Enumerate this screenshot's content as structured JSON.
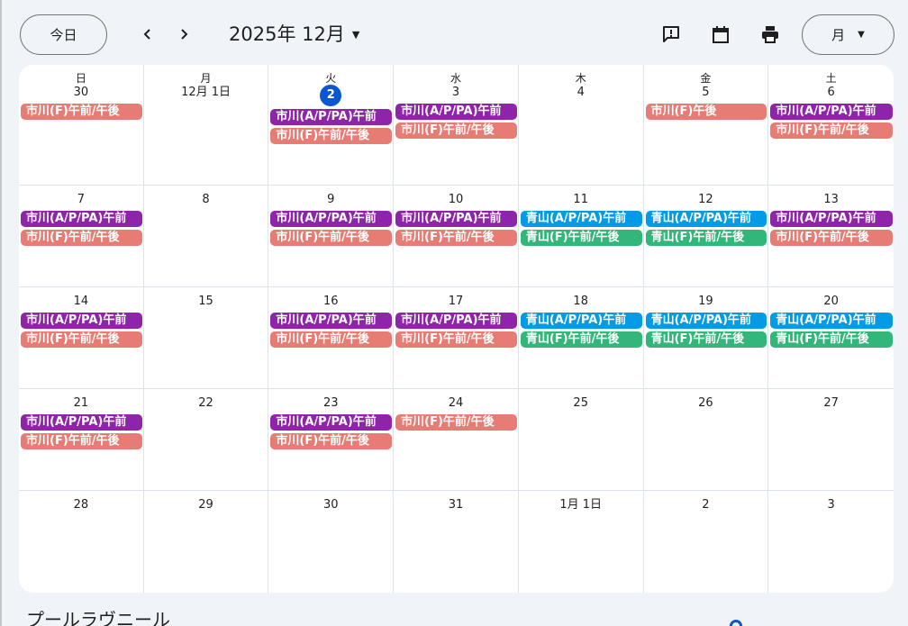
{
  "toolbar": {
    "today_label": "今日",
    "prev_label": "‹",
    "next_label": "›",
    "month_title": "2025年 12月",
    "view_label": "月",
    "caret": "▼"
  },
  "colors": {
    "ichikawa_ap": "#8e24aa",
    "ichikawa_f": "#e67c73",
    "aoyama_ap": "#039be5",
    "aoyama_f": "#33b679",
    "today_badge": "#0b57d0"
  },
  "weekdays": [
    "日",
    "月",
    "火",
    "水",
    "木",
    "金",
    "土"
  ],
  "weeks": [
    [
      {
        "label": "30",
        "events": [
          {
            "text": "市川(F)午前/午後",
            "type": "ichikawa-f"
          }
        ]
      },
      {
        "label": "12月 1日",
        "events": []
      },
      {
        "label": "2",
        "today": true,
        "events": [
          {
            "text": "市川(A/P/PA)午前",
            "type": "ichikawa-a"
          },
          {
            "text": "市川(F)午前/午後",
            "type": "ichikawa-f"
          }
        ]
      },
      {
        "label": "3",
        "events": [
          {
            "text": "市川(A/P/PA)午前",
            "type": "ichikawa-a"
          },
          {
            "text": "市川(F)午前/午後",
            "type": "ichikawa-f"
          }
        ]
      },
      {
        "label": "4",
        "events": []
      },
      {
        "label": "5",
        "events": [
          {
            "text": "市川(F)午後",
            "type": "ichikawa-f"
          }
        ]
      },
      {
        "label": "6",
        "events": [
          {
            "text": "市川(A/P/PA)午前",
            "type": "ichikawa-a"
          },
          {
            "text": "市川(F)午前/午後",
            "type": "ichikawa-f"
          }
        ]
      }
    ],
    [
      {
        "label": "7",
        "events": [
          {
            "text": "市川(A/P/PA)午前",
            "type": "ichikawa-a"
          },
          {
            "text": "市川(F)午前/午後",
            "type": "ichikawa-f"
          }
        ]
      },
      {
        "label": "8",
        "events": []
      },
      {
        "label": "9",
        "events": [
          {
            "text": "市川(A/P/PA)午前",
            "type": "ichikawa-a"
          },
          {
            "text": "市川(F)午前/午後",
            "type": "ichikawa-f"
          }
        ]
      },
      {
        "label": "10",
        "events": [
          {
            "text": "市川(A/P/PA)午前",
            "type": "ichikawa-a"
          },
          {
            "text": "市川(F)午前/午後",
            "type": "ichikawa-f"
          }
        ]
      },
      {
        "label": "11",
        "events": [
          {
            "text": "青山(A/P/PA)午前",
            "type": "aoyama-a"
          },
          {
            "text": "青山(F)午前/午後",
            "type": "aoyama-f"
          }
        ]
      },
      {
        "label": "12",
        "events": [
          {
            "text": "青山(A/P/PA)午前",
            "type": "aoyama-a"
          },
          {
            "text": "青山(F)午前/午後",
            "type": "aoyama-f"
          }
        ]
      },
      {
        "label": "13",
        "events": [
          {
            "text": "市川(A/P/PA)午前",
            "type": "ichikawa-a"
          },
          {
            "text": "市川(F)午前/午後",
            "type": "ichikawa-f"
          }
        ]
      }
    ],
    [
      {
        "label": "14",
        "events": [
          {
            "text": "市川(A/P/PA)午前",
            "type": "ichikawa-a"
          },
          {
            "text": "市川(F)午前/午後",
            "type": "ichikawa-f"
          }
        ]
      },
      {
        "label": "15",
        "events": []
      },
      {
        "label": "16",
        "events": [
          {
            "text": "市川(A/P/PA)午前",
            "type": "ichikawa-a"
          },
          {
            "text": "市川(F)午前/午後",
            "type": "ichikawa-f"
          }
        ]
      },
      {
        "label": "17",
        "events": [
          {
            "text": "市川(A/P/PA)午前",
            "type": "ichikawa-a"
          },
          {
            "text": "市川(F)午前/午後",
            "type": "ichikawa-f"
          }
        ]
      },
      {
        "label": "18",
        "events": [
          {
            "text": "青山(A/P/PA)午前",
            "type": "aoyama-a"
          },
          {
            "text": "青山(F)午前/午後",
            "type": "aoyama-f"
          }
        ]
      },
      {
        "label": "19",
        "events": [
          {
            "text": "青山(A/P/PA)午前",
            "type": "aoyama-a"
          },
          {
            "text": "青山(F)午前/午後",
            "type": "aoyama-f"
          }
        ]
      },
      {
        "label": "20",
        "events": [
          {
            "text": "青山(A/P/PA)午前",
            "type": "aoyama-a"
          },
          {
            "text": "青山(F)午前/午後",
            "type": "aoyama-f"
          }
        ]
      }
    ],
    [
      {
        "label": "21",
        "events": [
          {
            "text": "市川(A/P/PA)午前",
            "type": "ichikawa-a"
          },
          {
            "text": "市川(F)午前/午後",
            "type": "ichikawa-f"
          }
        ]
      },
      {
        "label": "22",
        "events": []
      },
      {
        "label": "23",
        "events": [
          {
            "text": "市川(A/P/PA)午前",
            "type": "ichikawa-a"
          },
          {
            "text": "市川(F)午前/午後",
            "type": "ichikawa-f"
          }
        ]
      },
      {
        "label": "24",
        "events": [
          {
            "text": "市川(F)午前/午後",
            "type": "ichikawa-f"
          }
        ]
      },
      {
        "label": "25",
        "events": []
      },
      {
        "label": "26",
        "events": []
      },
      {
        "label": "27",
        "events": []
      }
    ],
    [
      {
        "label": "28",
        "events": []
      },
      {
        "label": "29",
        "events": []
      },
      {
        "label": "30",
        "events": []
      },
      {
        "label": "31",
        "events": []
      },
      {
        "label": "1月 1日",
        "events": []
      },
      {
        "label": "2",
        "events": []
      },
      {
        "label": "3",
        "events": []
      }
    ]
  ],
  "footer": {
    "title": "プールラヴニール"
  }
}
